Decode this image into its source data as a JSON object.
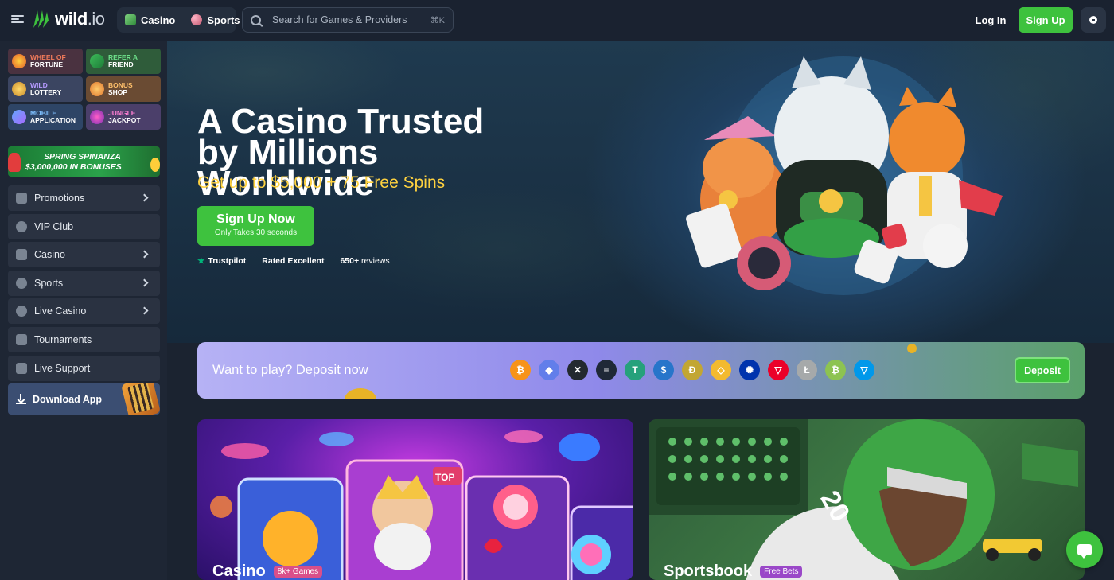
{
  "header": {
    "logo_text_left": "wild",
    "logo_text_right": ".io",
    "nav": [
      {
        "label": "Casino",
        "icon": "casino-icon"
      },
      {
        "label": "Sports",
        "icon": "sports-icon"
      }
    ],
    "search_placeholder": "Search for Games & Providers",
    "search_shortcut": "⌘K",
    "login_label": "Log In",
    "signup_label": "Sign Up"
  },
  "sidebar": {
    "tiles": [
      {
        "line1": "WHEEL OF",
        "line2": "FORTUNE"
      },
      {
        "line1": "REFER A",
        "line2": "FRIEND"
      },
      {
        "line1": "WILD",
        "line2": "LOTTERY"
      },
      {
        "line1": "BONUS",
        "line2": "SHOP"
      },
      {
        "line1": "MOBILE",
        "line2": "APPLICATION"
      },
      {
        "line1": "JUNGLE",
        "line2": "JACKPOT"
      }
    ],
    "promo_line1": "SPRING SPINANZA",
    "promo_line2": "$3,000,000 IN BONUSES",
    "items": [
      {
        "label": "Promotions",
        "has_chevron": true
      },
      {
        "label": "VIP Club",
        "has_chevron": false
      },
      {
        "label": "Casino",
        "has_chevron": true
      },
      {
        "label": "Sports",
        "has_chevron": true
      },
      {
        "label": "Live Casino",
        "has_chevron": true
      },
      {
        "label": "Tournaments",
        "has_chevron": false
      },
      {
        "label": "Live Support",
        "has_chevron": false
      }
    ],
    "download_label": "Download App"
  },
  "hero": {
    "title": "A Casino Trusted by Millions Worldwide",
    "subtitle": "Get up to $5,000 + 75 Free Spins",
    "cta_label": "Sign Up Now",
    "cta_sub": "Only Takes 30 seconds",
    "trust_brand": "Trustpilot",
    "trust_rating": "Rated Excellent",
    "trust_reviews_count": "650+",
    "trust_reviews_word": "reviews"
  },
  "deposit": {
    "text": "Want to play? Deposit now",
    "button_label": "Deposit",
    "coins": [
      {
        "name": "bitcoin-icon",
        "glyph": "₿",
        "color": "#f7931a"
      },
      {
        "name": "ethereum-icon",
        "glyph": "◆",
        "color": "#627eea"
      },
      {
        "name": "xrp-icon",
        "glyph": "✕",
        "color": "#23292f"
      },
      {
        "name": "solana-icon",
        "glyph": "≡",
        "color": "#1f2937"
      },
      {
        "name": "tether-icon",
        "glyph": "T",
        "color": "#26a17b"
      },
      {
        "name": "usdc-icon",
        "glyph": "$",
        "color": "#2775ca"
      },
      {
        "name": "dogecoin-icon",
        "glyph": "Ð",
        "color": "#c2a633"
      },
      {
        "name": "bnb-icon",
        "glyph": "◇",
        "color": "#f3ba2f"
      },
      {
        "name": "cardano-icon",
        "glyph": "✺",
        "color": "#0033ad"
      },
      {
        "name": "tron-icon",
        "glyph": "▽",
        "color": "#eb0029"
      },
      {
        "name": "litecoin-icon",
        "glyph": "Ł",
        "color": "#a6a9aa"
      },
      {
        "name": "bitcoin-cash-icon",
        "glyph": "₿",
        "color": "#8dc351"
      },
      {
        "name": "ton-icon",
        "glyph": "▽",
        "color": "#0098ea"
      }
    ]
  },
  "cards": {
    "casino_label": "Casino",
    "casino_badge": "8k+ Games",
    "casino_slot_tag": "TOP",
    "sport_label": "Sportsbook",
    "sport_badge": "Free Bets",
    "sport_jersey": "20"
  }
}
